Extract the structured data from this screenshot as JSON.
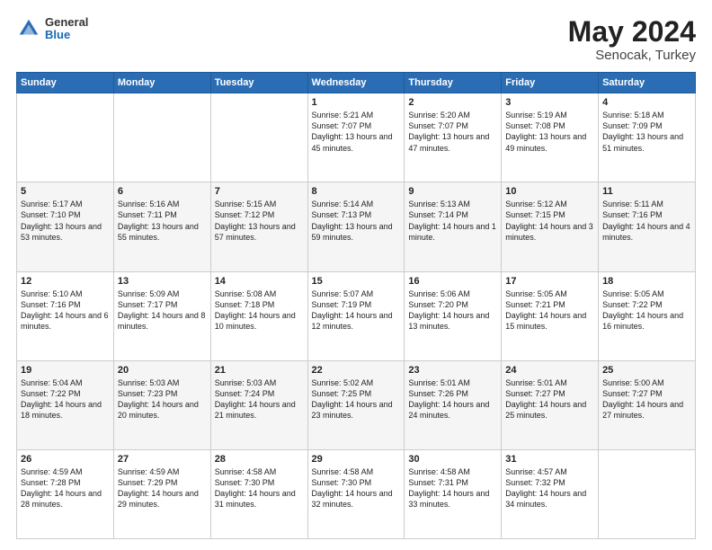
{
  "header": {
    "logo_general": "General",
    "logo_blue": "Blue",
    "title_month": "May 2024",
    "title_location": "Senocak, Turkey"
  },
  "days_of_week": [
    "Sunday",
    "Monday",
    "Tuesday",
    "Wednesday",
    "Thursday",
    "Friday",
    "Saturday"
  ],
  "weeks": [
    [
      {
        "num": "",
        "sunrise": "",
        "sunset": "",
        "daylight": ""
      },
      {
        "num": "",
        "sunrise": "",
        "sunset": "",
        "daylight": ""
      },
      {
        "num": "",
        "sunrise": "",
        "sunset": "",
        "daylight": ""
      },
      {
        "num": "1",
        "sunrise": "Sunrise: 5:21 AM",
        "sunset": "Sunset: 7:07 PM",
        "daylight": "Daylight: 13 hours and 45 minutes."
      },
      {
        "num": "2",
        "sunrise": "Sunrise: 5:20 AM",
        "sunset": "Sunset: 7:07 PM",
        "daylight": "Daylight: 13 hours and 47 minutes."
      },
      {
        "num": "3",
        "sunrise": "Sunrise: 5:19 AM",
        "sunset": "Sunset: 7:08 PM",
        "daylight": "Daylight: 13 hours and 49 minutes."
      },
      {
        "num": "4",
        "sunrise": "Sunrise: 5:18 AM",
        "sunset": "Sunset: 7:09 PM",
        "daylight": "Daylight: 13 hours and 51 minutes."
      }
    ],
    [
      {
        "num": "5",
        "sunrise": "Sunrise: 5:17 AM",
        "sunset": "Sunset: 7:10 PM",
        "daylight": "Daylight: 13 hours and 53 minutes."
      },
      {
        "num": "6",
        "sunrise": "Sunrise: 5:16 AM",
        "sunset": "Sunset: 7:11 PM",
        "daylight": "Daylight: 13 hours and 55 minutes."
      },
      {
        "num": "7",
        "sunrise": "Sunrise: 5:15 AM",
        "sunset": "Sunset: 7:12 PM",
        "daylight": "Daylight: 13 hours and 57 minutes."
      },
      {
        "num": "8",
        "sunrise": "Sunrise: 5:14 AM",
        "sunset": "Sunset: 7:13 PM",
        "daylight": "Daylight: 13 hours and 59 minutes."
      },
      {
        "num": "9",
        "sunrise": "Sunrise: 5:13 AM",
        "sunset": "Sunset: 7:14 PM",
        "daylight": "Daylight: 14 hours and 1 minute."
      },
      {
        "num": "10",
        "sunrise": "Sunrise: 5:12 AM",
        "sunset": "Sunset: 7:15 PM",
        "daylight": "Daylight: 14 hours and 3 minutes."
      },
      {
        "num": "11",
        "sunrise": "Sunrise: 5:11 AM",
        "sunset": "Sunset: 7:16 PM",
        "daylight": "Daylight: 14 hours and 4 minutes."
      }
    ],
    [
      {
        "num": "12",
        "sunrise": "Sunrise: 5:10 AM",
        "sunset": "Sunset: 7:16 PM",
        "daylight": "Daylight: 14 hours and 6 minutes."
      },
      {
        "num": "13",
        "sunrise": "Sunrise: 5:09 AM",
        "sunset": "Sunset: 7:17 PM",
        "daylight": "Daylight: 14 hours and 8 minutes."
      },
      {
        "num": "14",
        "sunrise": "Sunrise: 5:08 AM",
        "sunset": "Sunset: 7:18 PM",
        "daylight": "Daylight: 14 hours and 10 minutes."
      },
      {
        "num": "15",
        "sunrise": "Sunrise: 5:07 AM",
        "sunset": "Sunset: 7:19 PM",
        "daylight": "Daylight: 14 hours and 12 minutes."
      },
      {
        "num": "16",
        "sunrise": "Sunrise: 5:06 AM",
        "sunset": "Sunset: 7:20 PM",
        "daylight": "Daylight: 14 hours and 13 minutes."
      },
      {
        "num": "17",
        "sunrise": "Sunrise: 5:05 AM",
        "sunset": "Sunset: 7:21 PM",
        "daylight": "Daylight: 14 hours and 15 minutes."
      },
      {
        "num": "18",
        "sunrise": "Sunrise: 5:05 AM",
        "sunset": "Sunset: 7:22 PM",
        "daylight": "Daylight: 14 hours and 16 minutes."
      }
    ],
    [
      {
        "num": "19",
        "sunrise": "Sunrise: 5:04 AM",
        "sunset": "Sunset: 7:22 PM",
        "daylight": "Daylight: 14 hours and 18 minutes."
      },
      {
        "num": "20",
        "sunrise": "Sunrise: 5:03 AM",
        "sunset": "Sunset: 7:23 PM",
        "daylight": "Daylight: 14 hours and 20 minutes."
      },
      {
        "num": "21",
        "sunrise": "Sunrise: 5:03 AM",
        "sunset": "Sunset: 7:24 PM",
        "daylight": "Daylight: 14 hours and 21 minutes."
      },
      {
        "num": "22",
        "sunrise": "Sunrise: 5:02 AM",
        "sunset": "Sunset: 7:25 PM",
        "daylight": "Daylight: 14 hours and 23 minutes."
      },
      {
        "num": "23",
        "sunrise": "Sunrise: 5:01 AM",
        "sunset": "Sunset: 7:26 PM",
        "daylight": "Daylight: 14 hours and 24 minutes."
      },
      {
        "num": "24",
        "sunrise": "Sunrise: 5:01 AM",
        "sunset": "Sunset: 7:27 PM",
        "daylight": "Daylight: 14 hours and 25 minutes."
      },
      {
        "num": "25",
        "sunrise": "Sunrise: 5:00 AM",
        "sunset": "Sunset: 7:27 PM",
        "daylight": "Daylight: 14 hours and 27 minutes."
      }
    ],
    [
      {
        "num": "26",
        "sunrise": "Sunrise: 4:59 AM",
        "sunset": "Sunset: 7:28 PM",
        "daylight": "Daylight: 14 hours and 28 minutes."
      },
      {
        "num": "27",
        "sunrise": "Sunrise: 4:59 AM",
        "sunset": "Sunset: 7:29 PM",
        "daylight": "Daylight: 14 hours and 29 minutes."
      },
      {
        "num": "28",
        "sunrise": "Sunrise: 4:58 AM",
        "sunset": "Sunset: 7:30 PM",
        "daylight": "Daylight: 14 hours and 31 minutes."
      },
      {
        "num": "29",
        "sunrise": "Sunrise: 4:58 AM",
        "sunset": "Sunset: 7:30 PM",
        "daylight": "Daylight: 14 hours and 32 minutes."
      },
      {
        "num": "30",
        "sunrise": "Sunrise: 4:58 AM",
        "sunset": "Sunset: 7:31 PM",
        "daylight": "Daylight: 14 hours and 33 minutes."
      },
      {
        "num": "31",
        "sunrise": "Sunrise: 4:57 AM",
        "sunset": "Sunset: 7:32 PM",
        "daylight": "Daylight: 14 hours and 34 minutes."
      },
      {
        "num": "",
        "sunrise": "",
        "sunset": "",
        "daylight": ""
      }
    ]
  ]
}
